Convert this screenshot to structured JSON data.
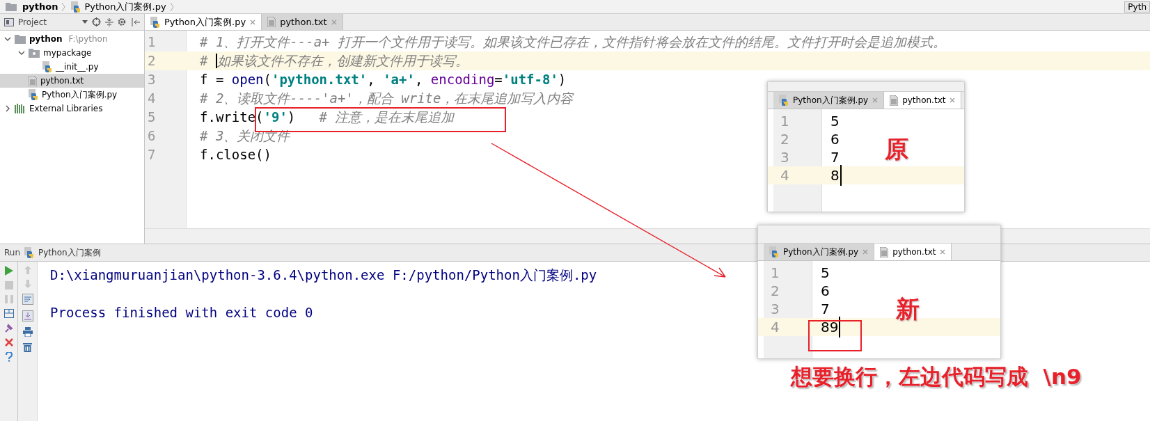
{
  "breadcrumb": [
    {
      "label": "python",
      "kind": "project"
    },
    {
      "label": "Python入门案例.py",
      "kind": "file"
    }
  ],
  "top_right_button": "Pyth",
  "project_panel": {
    "title": "Project",
    "tree": [
      {
        "label": "python",
        "path": "F:\\python",
        "kind": "root",
        "expanded": true,
        "selected": false,
        "children": [
          {
            "label": "mypackage",
            "kind": "package",
            "expanded": true,
            "selected": false,
            "children": [
              {
                "label": "__init__.py",
                "kind": "py",
                "selected": false
              }
            ]
          },
          {
            "label": "python.txt",
            "kind": "txt",
            "selected": true
          },
          {
            "label": "Python入门案例.py",
            "kind": "py",
            "selected": false
          }
        ]
      },
      {
        "label": "External Libraries",
        "kind": "libs",
        "expanded": false,
        "selected": false
      }
    ]
  },
  "editor": {
    "tabs": [
      {
        "label": "Python入门案例.py",
        "kind": "py",
        "selected": true
      },
      {
        "label": "python.txt",
        "kind": "txt",
        "selected": false
      }
    ],
    "lines": [
      {
        "number": "1",
        "current": false,
        "tokens": [
          {
            "kind": "comment",
            "text": "# 1、打开文件---a+ 打开一个文件用于读写。如果该文件已存在，文件指针将会放在文件的结尾。文件打开时会是追加模式。"
          }
        ]
      },
      {
        "number": "2",
        "current": true,
        "tokens": [
          {
            "kind": "comment",
            "text": "# "
          },
          {
            "kind": "caret"
          },
          {
            "kind": "comment",
            "text": "如果该文件不存在，创建新文件用于读写。"
          }
        ]
      },
      {
        "number": "3",
        "current": false,
        "tokens": [
          {
            "kind": "plain",
            "text": "f = "
          },
          {
            "kind": "builtin",
            "text": "open"
          },
          {
            "kind": "plain",
            "text": "("
          },
          {
            "kind": "string",
            "text": "'python.txt'"
          },
          {
            "kind": "plain",
            "text": ", "
          },
          {
            "kind": "string",
            "text": "'a+'"
          },
          {
            "kind": "plain",
            "text": ", "
          },
          {
            "kind": "kwarg",
            "text": "encoding"
          },
          {
            "kind": "plain",
            "text": "="
          },
          {
            "kind": "string",
            "text": "'utf-8'"
          },
          {
            "kind": "plain",
            "text": ")"
          }
        ]
      },
      {
        "number": "4",
        "current": false,
        "tokens": [
          {
            "kind": "comment",
            "text": "# 2、读取文件----'a+'，配合 write，在末尾追加写入内容"
          }
        ]
      },
      {
        "number": "5",
        "current": false,
        "tokens": [
          {
            "kind": "plain",
            "text": "f.write("
          },
          {
            "kind": "string",
            "text": "'9'"
          },
          {
            "kind": "plain",
            "text": ")   "
          },
          {
            "kind": "comment",
            "text": "# 注意，是在末尾追加"
          }
        ]
      },
      {
        "number": "6",
        "current": false,
        "tokens": [
          {
            "kind": "comment",
            "text": "# 3、关闭文件"
          }
        ]
      },
      {
        "number": "7",
        "current": false,
        "tokens": [
          {
            "kind": "plain",
            "text": "f.close()"
          }
        ]
      }
    ]
  },
  "run_panel": {
    "label": "Run",
    "tab": "Python入门案例",
    "output": [
      {
        "kind": "command",
        "text": "D:\\xiangmuruanjian\\python-3.6.4\\python.exe F:/python/Python入门案例.py"
      },
      {
        "kind": "status",
        "text": "Process finished with exit code 0"
      }
    ]
  },
  "snapshots": [
    {
      "tabs": [
        {
          "label": "Python入门案例.py",
          "kind": "py",
          "selected": false
        },
        {
          "label": "python.txt",
          "kind": "txt",
          "selected": true
        }
      ],
      "lines": [
        {
          "number": "1",
          "text": "5",
          "current": false
        },
        {
          "number": "2",
          "text": "6",
          "current": false
        },
        {
          "number": "3",
          "text": "7",
          "current": false
        },
        {
          "number": "4",
          "text": "8",
          "current": true
        }
      ],
      "note": "原"
    },
    {
      "tabs": [
        {
          "label": "Python入门案例.py",
          "kind": "py",
          "selected": false
        },
        {
          "label": "python.txt",
          "kind": "txt",
          "selected": true
        }
      ],
      "lines": [
        {
          "number": "1",
          "text": "5",
          "current": false
        },
        {
          "number": "2",
          "text": "6",
          "current": false
        },
        {
          "number": "3",
          "text": "7",
          "current": false
        },
        {
          "number": "4",
          "text": "89",
          "current": true
        }
      ],
      "note": "新"
    }
  ],
  "caption": "想要换行，左边代码写成  \\n9"
}
